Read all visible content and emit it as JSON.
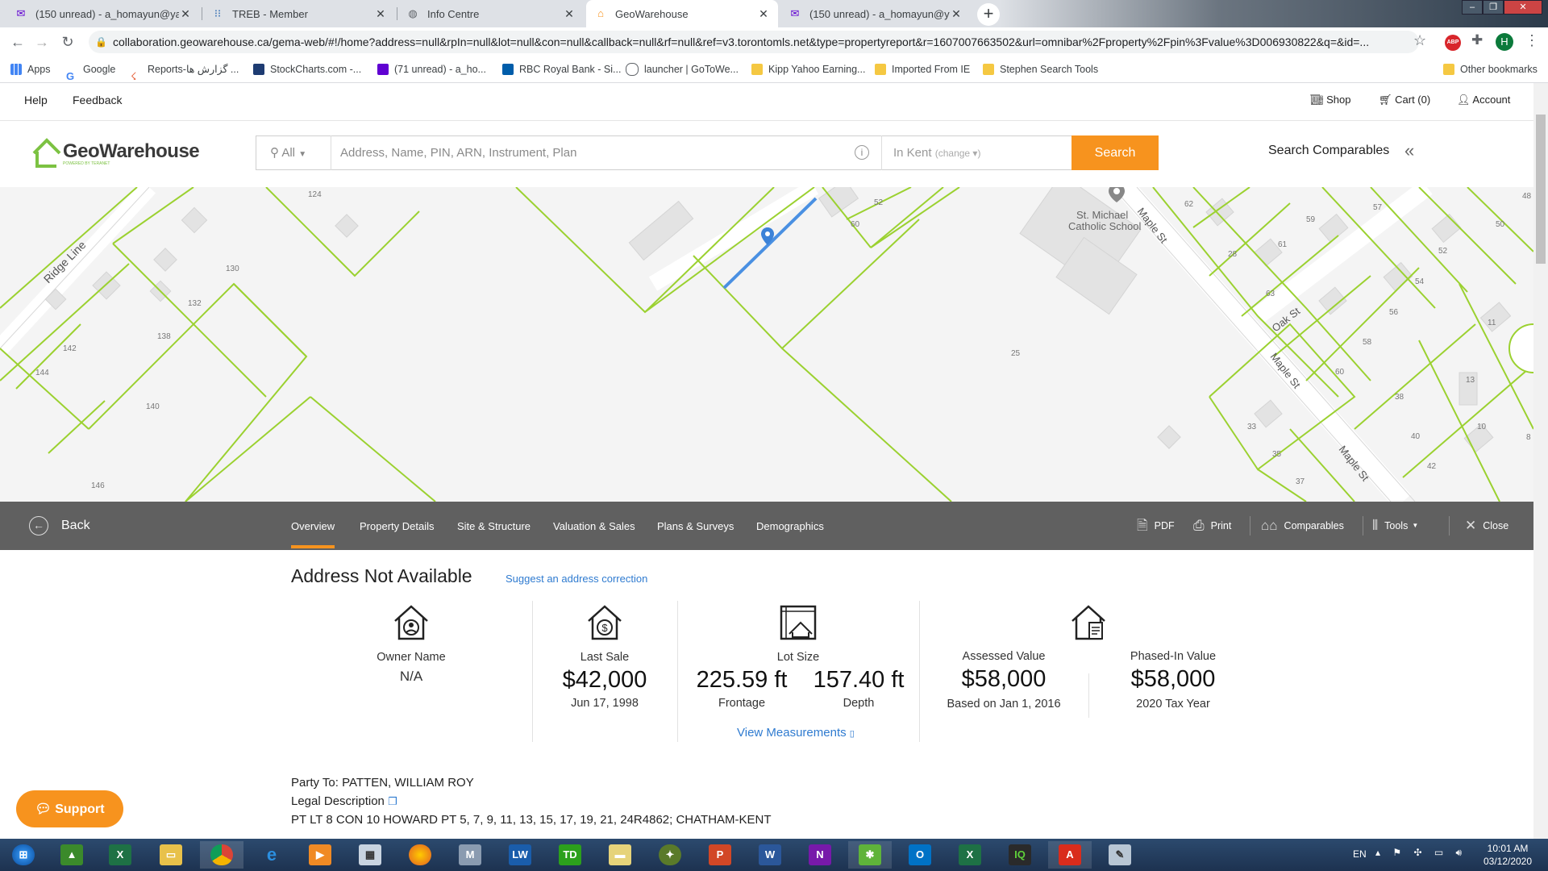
{
  "browser": {
    "tabs": [
      {
        "title": "(150 unread) - a_homayun@yahoo",
        "icon": "mail-icon",
        "active": false
      },
      {
        "title": "TREB - Member",
        "icon": "treb-icon",
        "active": false
      },
      {
        "title": "Info Centre",
        "icon": "globe-icon",
        "active": false
      },
      {
        "title": "GeoWarehouse",
        "icon": "house-icon",
        "active": true
      },
      {
        "title": "(150 unread) - a_homayun@yahoo",
        "icon": "mail-icon",
        "active": false
      }
    ],
    "url": "collaboration.geowarehouse.ca/gema-web/#!/home?address=null&rpIn=null&lot=null&con=null&callback=null&rf=null&ref=v3.torontomls.net&type=propertyreport&r=1607007663502&url=omnibar%2Fproperty%2Fpin%3Fvalue%3D006930822&q=&id=...",
    "bookmarks": [
      "Apps",
      "Google",
      "Reports-گزارش ها ...",
      "StockCharts.com -...",
      "(71 unread) - a_ho...",
      "RBC Royal Bank - Si...",
      "launcher | GoToWe...",
      "Kipp Yahoo Earning...",
      "Imported From IE",
      "Stephen Search Tools"
    ],
    "other_bookmarks": "Other bookmarks",
    "profile_initial": "H"
  },
  "site": {
    "help": "Help",
    "feedback": "Feedback",
    "shop": "Shop",
    "cart": "Cart (0)",
    "account": "Account",
    "logo": "GeoWarehouse",
    "logo_tagline": "POWERED BY TERANET",
    "search_scope": "All",
    "search_placeholder": "Address, Name, PIN, ARN, Instrument, Plan",
    "location": "In Kent",
    "location_change": "(change ▾)",
    "search_button": "Search",
    "search_comparables": "Search Comparables"
  },
  "map": {
    "labels": {
      "ridge_line": "Ridge Line",
      "maple_st": "Maple St",
      "oak_st": "Oak St",
      "school": "St. Michael",
      "school2": "Catholic School"
    },
    "lot_numbers": [
      "124",
      "130",
      "132",
      "138",
      "142",
      "144",
      "140",
      "146",
      "52",
      "60",
      "25",
      "62",
      "59",
      "57",
      "61",
      "28",
      "63",
      "48",
      "50",
      "52",
      "54",
      "56",
      "11",
      "58",
      "60",
      "13",
      "38",
      "40",
      "10",
      "33",
      "35",
      "42",
      "37",
      "8"
    ]
  },
  "property_nav": {
    "back": "Back",
    "tabs": [
      "Overview",
      "Property Details",
      "Site & Structure",
      "Valuation & Sales",
      "Plans & Surveys",
      "Demographics"
    ],
    "tools": {
      "pdf": "PDF",
      "print": "Print",
      "comparables": "Comparables",
      "tools": "Tools",
      "close": "Close"
    }
  },
  "overview": {
    "address": "Address Not Available",
    "suggest": "Suggest an address correction",
    "owner": {
      "label": "Owner Name",
      "value": "N/A"
    },
    "last_sale": {
      "label": "Last Sale",
      "value": "$42,000",
      "date": "Jun 17, 1998"
    },
    "lot_size": {
      "label": "Lot Size",
      "frontage": "225.59 ft",
      "frontage_label": "Frontage",
      "depth": "157.40 ft",
      "depth_label": "Depth",
      "view": "View Measurements"
    },
    "assessed": {
      "label": "Assessed Value",
      "value": "$58,000",
      "sub": "Based on Jan 1, 2016"
    },
    "phased": {
      "label": "Phased-In Value",
      "value": "$58,000",
      "sub": "2020 Tax Year"
    },
    "party": "Party To: PATTEN, WILLIAM ROY",
    "legal_label": "Legal Description",
    "legal": "PT LT 8 CON 10 HOWARD PT 5, 7, 9, 11, 13, 15, 17, 19, 21, 24R4862; CHATHAM-KENT"
  },
  "support": "Support",
  "taskbar": {
    "lang": "EN",
    "time": "10:01 AM",
    "date": "03/12/2020"
  },
  "colors": {
    "accent": "#f7931e",
    "lot_line": "#9bd130",
    "selected_line": "#4a90e2",
    "link": "#2f7bd0"
  }
}
